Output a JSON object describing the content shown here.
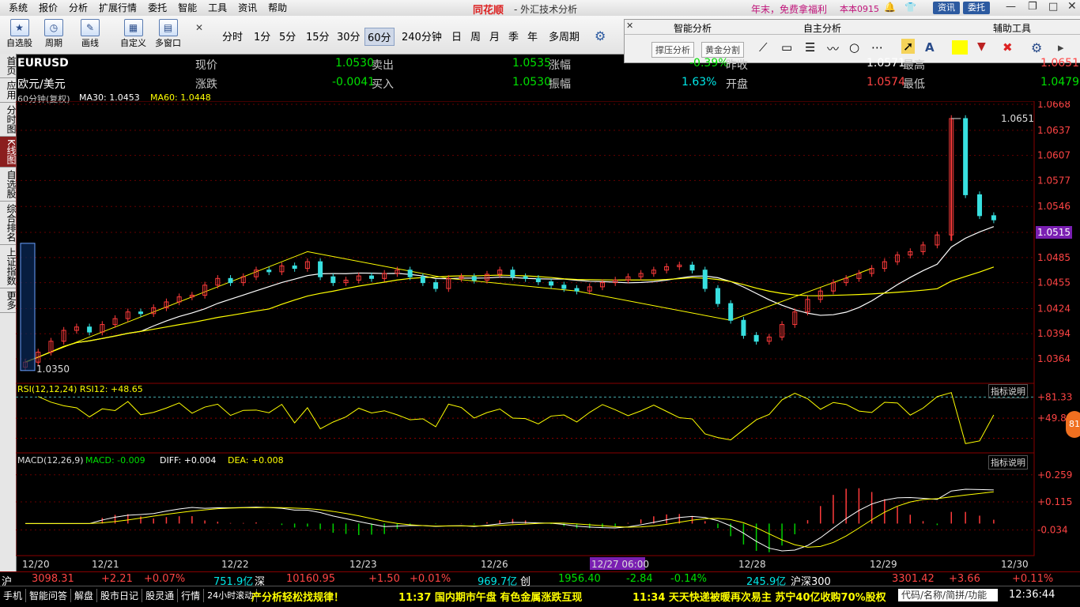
{
  "titlebar": {
    "menu": [
      "系统",
      "报价",
      "分析",
      "扩展行情",
      "委托",
      "智能",
      "工具",
      "资讯",
      "帮助"
    ],
    "brand": "同花顺",
    "title": "- 外汇技术分析",
    "promo": "年末，免费拿福利",
    "edition": "本本0915",
    "btn_news": "资讯",
    "btn_trade": "委托"
  },
  "toolbar": {
    "tools": [
      {
        "label": "自选股",
        "icon": "star-icon"
      },
      {
        "label": "周期",
        "icon": "clock-icon"
      },
      {
        "label": "画线",
        "icon": "pen-icon"
      },
      {
        "label": "自定义",
        "icon": "grid-icon"
      },
      {
        "label": "多窗口",
        "icon": "windows-icon"
      }
    ],
    "periods": [
      "分时",
      "1分",
      "5分",
      "15分",
      "30分",
      "60分",
      "240分钟",
      "日",
      "周",
      "月",
      "季",
      "年",
      "多周期"
    ],
    "active_period": "60分"
  },
  "panel": {
    "sections": [
      "智能分析",
      "自主分析",
      "辅助工具"
    ],
    "buttons": [
      "撑压分析",
      "黄金分割"
    ]
  },
  "sidebar": [
    "首页",
    "应用",
    "分时图",
    "K线图",
    "自选股",
    "综合排名",
    "上证指数",
    "更多"
  ],
  "quote": {
    "symbol": "EURUSD",
    "name": "欧元/美元",
    "rows": [
      {
        "label": "现价",
        "value": "1.0530"
      },
      {
        "label": "涨跌",
        "value": "-0.0041"
      },
      {
        "label": "卖出",
        "value": "1.0535"
      },
      {
        "label": "买入",
        "value": "1.0530"
      },
      {
        "label": "涨幅",
        "value": "-0.39%"
      },
      {
        "label": "振幅",
        "value": "1.63%"
      },
      {
        "label": "昨收",
        "value": "1.0571"
      },
      {
        "label": "开盘",
        "value": "1.0574"
      },
      {
        "label": "最高",
        "value": "1.0651"
      },
      {
        "label": "最低",
        "value": "1.0479"
      }
    ],
    "indicator_line": "60分钟(复权)",
    "ma30": "MA30: 1.0453",
    "ma60": "MA60: 1.0448"
  },
  "chart_data": {
    "type": "line",
    "price_axis": [
      "1.0668",
      "1.0637",
      "1.0607",
      "1.0577",
      "1.0546",
      "1.0515",
      "1.0485",
      "1.0455",
      "1.0424",
      "1.0394",
      "1.0364"
    ],
    "current_price_tag": "1.0515",
    "high_label": "1.0651",
    "low_label": "1.0350",
    "x_labels": [
      "12/20",
      "12/21",
      "12/22",
      "12/23",
      "12/26",
      "12/27 06:00",
      "12/28",
      "12/29",
      "12/30"
    ],
    "closes": [
      1.036,
      1.0372,
      1.0385,
      1.0398,
      1.0402,
      1.0396,
      1.0405,
      1.0412,
      1.042,
      1.0418,
      1.0425,
      1.0432,
      1.0438,
      1.044,
      1.0452,
      1.046,
      1.0455,
      1.0462,
      1.047,
      1.0468,
      1.0475,
      1.0472,
      1.048,
      1.0462,
      1.0455,
      1.0458,
      1.0463,
      1.046,
      1.0466,
      1.047,
      1.0462,
      1.0455,
      1.0448,
      1.046,
      1.0462,
      1.0458,
      1.0465,
      1.047,
      1.0462,
      1.046,
      1.0456,
      1.0452,
      1.0448,
      1.0445,
      1.045,
      1.0455,
      1.0458,
      1.0462,
      1.0466,
      1.047,
      1.0474,
      1.0476,
      1.047,
      1.0448,
      1.043,
      1.041,
      1.0392,
      1.0385,
      1.039,
      1.0405,
      1.042,
      1.0435,
      1.0445,
      1.0455,
      1.046,
      1.0466,
      1.0472,
      1.048,
      1.0488,
      1.0492,
      1.05,
      1.0512,
      1.0651,
      1.056,
      1.0535,
      1.053
    ],
    "rsi": {
      "label": "RSI(12,12,24) RSI12: +48.65",
      "axis": [
        "+81.33",
        "+49.84"
      ],
      "marker": "81"
    },
    "macd": {
      "label": "MACD(12,26,9)",
      "macd": "MACD: -0.009",
      "diff": "DIFF: +0.004",
      "dea": "DEA: +0.008",
      "axis": [
        "+0.259",
        "+0.115",
        "-0.034"
      ]
    },
    "help_btn": "指标说明"
  },
  "indexbar": {
    "sh_name": "沪",
    "sh_value": "3098.31",
    "sh_chg": "+2.21",
    "sh_pct": "+0.07%",
    "sh_amt": "751.9亿",
    "sz_name": "深",
    "sz_value": "10160.95",
    "sz_chg": "+1.50",
    "sz_pct": "+0.01%",
    "sz_amt": "969.7亿",
    "cy_name": "创",
    "cy_value": "1956.40",
    "cy_chg": "-2.84",
    "cy_pct": "-0.14%",
    "cy_amt": "245.9亿",
    "hs_name": "沪深300",
    "hs_value": "3301.42",
    "hs_chg": "+3.66",
    "hs_pct": "+0.11%"
  },
  "statusbar": {
    "items": [
      "手机",
      "智能问答",
      "解盘",
      "股市日记",
      "股灵通",
      "行情",
      "24小时滚动"
    ],
    "ticker1": "产分析轻松找规律！",
    "ticker2": "11:37 国内期市午盘 有色金属涨跌互现",
    "ticker3": "11:34 天天快递被暖再次易主 苏宁40亿收购70%股权",
    "search_hint": "代码/名称/简拼/功能",
    "clock": "12:36:44"
  }
}
